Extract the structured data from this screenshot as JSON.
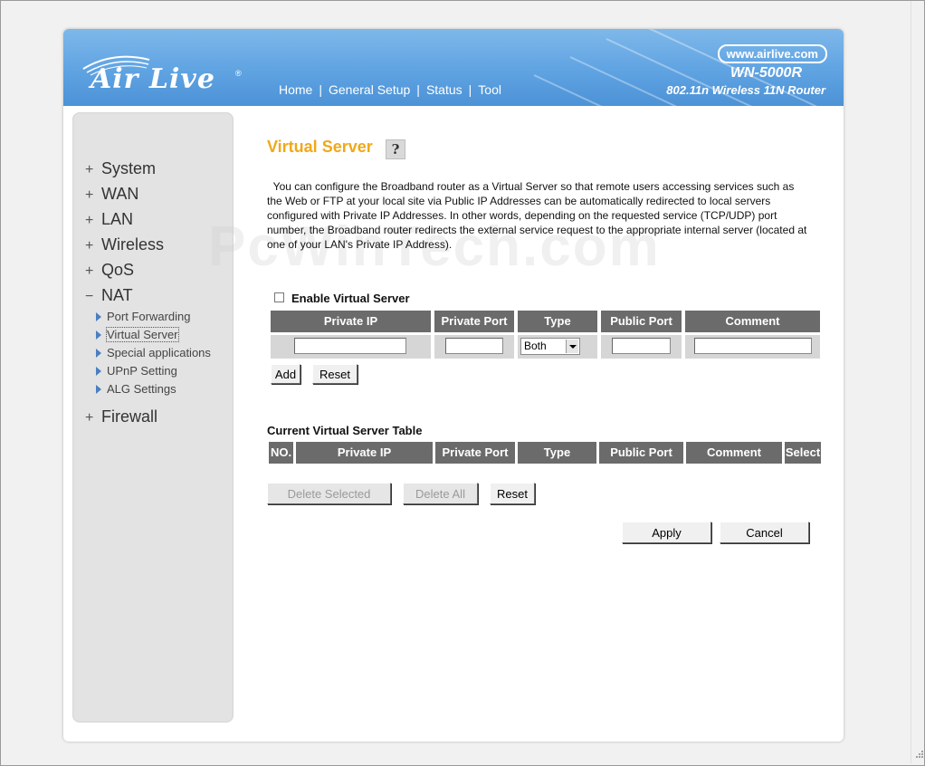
{
  "header": {
    "logo_text": "Air Live",
    "url": "www.airlive.com",
    "model": "WN-5000R",
    "subtitle": "802.11n Wireless 11N Router",
    "nav": [
      "Home",
      "General Setup",
      "Status",
      "Tool"
    ],
    "colors": {
      "banner": "#5fa3e2",
      "title": "#f0a818",
      "table_header": "#6b6b6b"
    }
  },
  "sidebar": {
    "items": [
      {
        "sign": "+",
        "label": "System"
      },
      {
        "sign": "+",
        "label": "WAN"
      },
      {
        "sign": "+",
        "label": "LAN"
      },
      {
        "sign": "+",
        "label": "Wireless"
      },
      {
        "sign": "+",
        "label": "QoS"
      },
      {
        "sign": "−",
        "label": "NAT"
      }
    ],
    "nat_sub": [
      "Port Forwarding",
      "Virtual Server",
      "Special applications",
      "UPnP Setting",
      "ALG Settings"
    ],
    "last": {
      "sign": "+",
      "label": "Firewall"
    }
  },
  "main": {
    "title": "Virtual Server",
    "help_icon": "help-icon",
    "description": "You can configure the Broadband router as a Virtual Server so that remote users accessing services such as the Web or FTP at your local site via Public IP Addresses can be automatically redirected to local servers configured with Private IP Addresses. In other words, depending on the requested service (TCP/UDP) port number, the Broadband router redirects the external service request to the appropriate internal server (located at one of your LAN's Private IP Address).",
    "watermark": "PcWinTech.com",
    "enable_label": "Enable Virtual Server",
    "form_headers": [
      "Private IP",
      "Private Port",
      "Type",
      "Public Port",
      "Comment"
    ],
    "type_selected": "Both",
    "add_label": "Add",
    "reset_label": "Reset",
    "table_title": "Current Virtual Server Table",
    "table_headers": [
      "NO.",
      "Private IP",
      "Private Port",
      "Type",
      "Public Port",
      "Comment",
      "Select"
    ],
    "delete_selected_label": "Delete Selected",
    "delete_all_label": "Delete All",
    "table_reset_label": "Reset",
    "apply_label": "Apply",
    "cancel_label": "Cancel"
  }
}
